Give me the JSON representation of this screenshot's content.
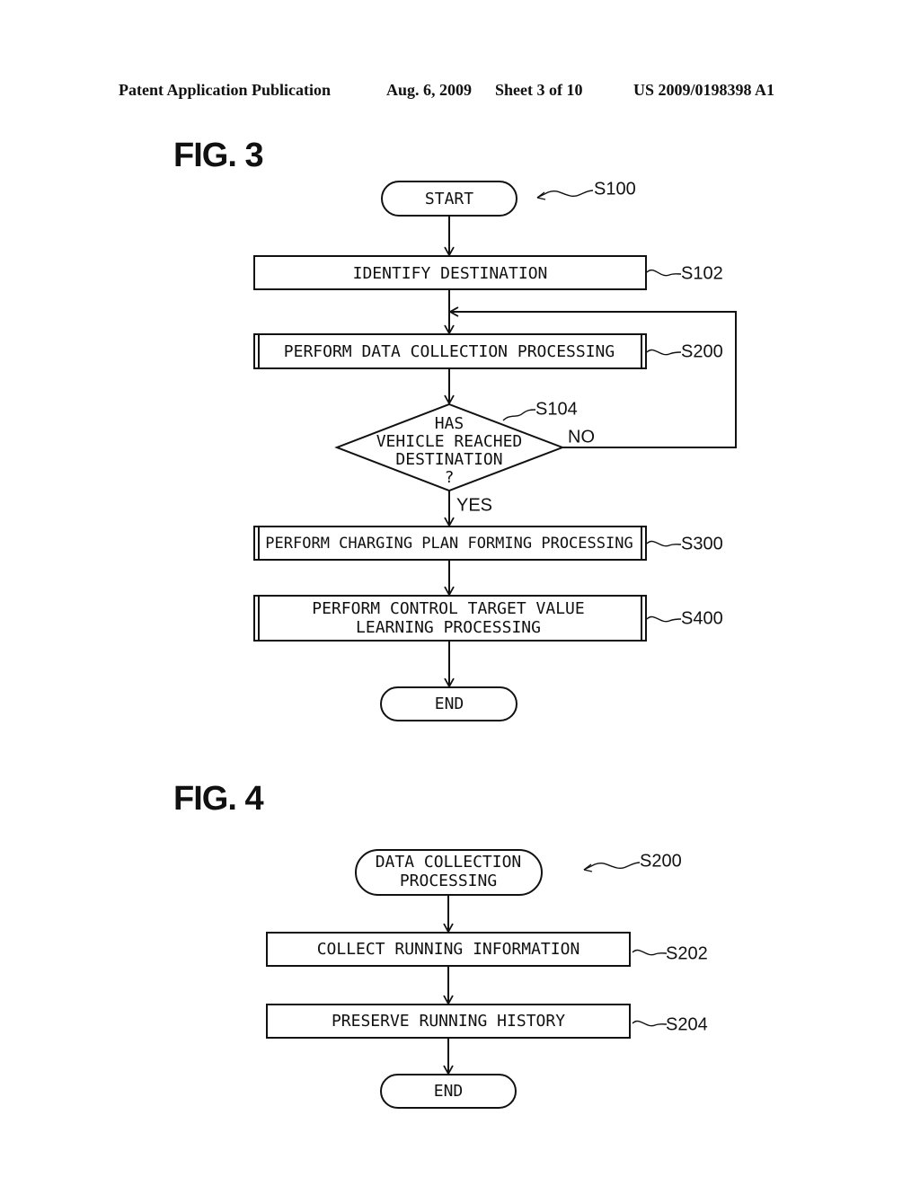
{
  "header": {
    "publication": "Patent Application Publication",
    "date": "Aug. 6, 2009",
    "sheet": "Sheet 3 of 10",
    "number": "US 2009/0198398 A1"
  },
  "fig3": {
    "title": "FIG. 3",
    "label": "S100",
    "start": "START",
    "steps": [
      {
        "id": "S102",
        "lines": [
          "IDENTIFY DESTINATION"
        ],
        "type": "process"
      },
      {
        "id": "S200",
        "lines": [
          "PERFORM DATA COLLECTION PROCESSING"
        ],
        "type": "subroutine"
      },
      {
        "id": "S104",
        "lines": [
          "HAS",
          "VEHICLE REACHED",
          "DESTINATION",
          "?"
        ],
        "type": "decision",
        "yes": "YES",
        "no": "NO"
      },
      {
        "id": "S300",
        "lines": [
          "PERFORM CHARGING PLAN FORMING PROCESSING"
        ],
        "type": "subroutine"
      },
      {
        "id": "S400",
        "lines": [
          "PERFORM CONTROL TARGET VALUE",
          "LEARNING PROCESSING"
        ],
        "type": "subroutine"
      }
    ],
    "end": "END"
  },
  "fig4": {
    "title": "FIG. 4",
    "label": "S200",
    "start_lines": [
      "DATA COLLECTION",
      "PROCESSING"
    ],
    "steps": [
      {
        "id": "S202",
        "lines": [
          "COLLECT RUNNING INFORMATION"
        ],
        "type": "process"
      },
      {
        "id": "S204",
        "lines": [
          "PRESERVE RUNNING HISTORY"
        ],
        "type": "process"
      }
    ],
    "end": "END"
  }
}
